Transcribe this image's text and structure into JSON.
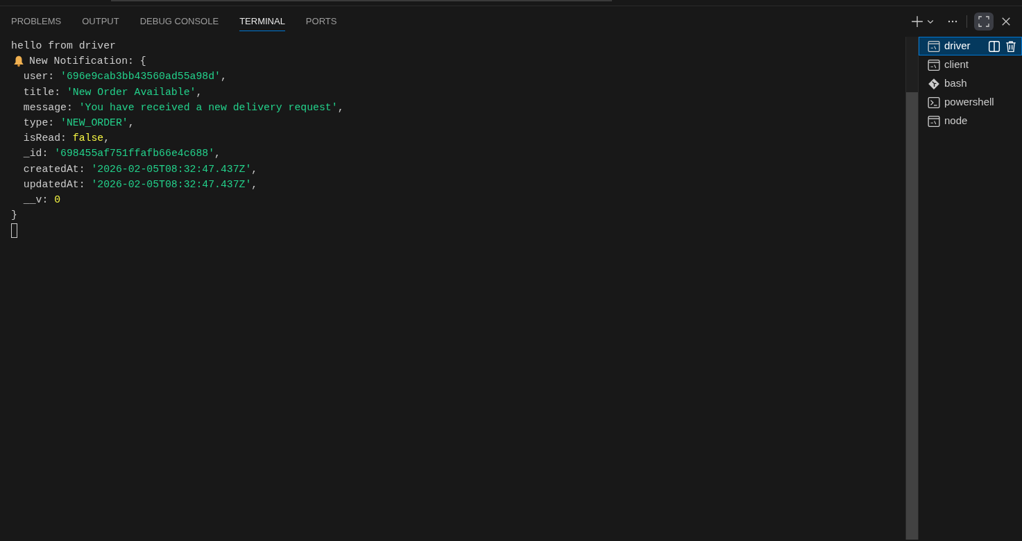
{
  "tabs": [
    {
      "label": "PROBLEMS",
      "selected": false
    },
    {
      "label": "OUTPUT",
      "selected": false
    },
    {
      "label": "DEBUG CONSOLE",
      "selected": false
    },
    {
      "label": "TERMINAL",
      "selected": true
    },
    {
      "label": "PORTS",
      "selected": false
    }
  ],
  "terminal_lines": [
    {
      "kind": "plain",
      "segments": [
        {
          "kind": "plain",
          "text": "hello from driver"
        }
      ]
    },
    {
      "kind": "alert",
      "segments": [
        {
          "kind": "plain",
          "text": "New Notification: {"
        }
      ]
    },
    {
      "kind": "plain",
      "segments": [
        {
          "kind": "plain",
          "text": "  user: "
        },
        {
          "kind": "string",
          "text": "'696e9cab3bb43560ad55a98d'"
        },
        {
          "kind": "plain",
          "text": ","
        }
      ]
    },
    {
      "kind": "plain",
      "segments": [
        {
          "kind": "plain",
          "text": "  title: "
        },
        {
          "kind": "string",
          "text": "'New Order Available'"
        },
        {
          "kind": "plain",
          "text": ","
        }
      ]
    },
    {
      "kind": "plain",
      "segments": [
        {
          "kind": "plain",
          "text": "  message: "
        },
        {
          "kind": "string",
          "text": "'You have received a new delivery request'"
        },
        {
          "kind": "plain",
          "text": ","
        }
      ]
    },
    {
      "kind": "plain",
      "segments": [
        {
          "kind": "plain",
          "text": "  type: "
        },
        {
          "kind": "string",
          "text": "'NEW_ORDER'"
        },
        {
          "kind": "plain",
          "text": ","
        }
      ]
    },
    {
      "kind": "plain",
      "segments": [
        {
          "kind": "plain",
          "text": "  isRead: "
        },
        {
          "kind": "literal",
          "text": "false"
        },
        {
          "kind": "plain",
          "text": ","
        }
      ]
    },
    {
      "kind": "plain",
      "segments": [
        {
          "kind": "plain",
          "text": "  _id: "
        },
        {
          "kind": "string",
          "text": "'698455af751ffafb66e4c688'"
        },
        {
          "kind": "plain",
          "text": ","
        }
      ]
    },
    {
      "kind": "plain",
      "segments": [
        {
          "kind": "plain",
          "text": "  createdAt: "
        },
        {
          "kind": "string",
          "text": "'2026-02-05T08:32:47.437Z'"
        },
        {
          "kind": "plain",
          "text": ","
        }
      ]
    },
    {
      "kind": "plain",
      "segments": [
        {
          "kind": "plain",
          "text": "  updatedAt: "
        },
        {
          "kind": "string",
          "text": "'2026-02-05T08:32:47.437Z'"
        },
        {
          "kind": "plain",
          "text": ","
        }
      ]
    },
    {
      "kind": "plain",
      "segments": [
        {
          "kind": "plain",
          "text": "  __v: "
        },
        {
          "kind": "literal",
          "text": "0"
        }
      ]
    },
    {
      "kind": "plain",
      "segments": [
        {
          "kind": "plain",
          "text": "}"
        }
      ]
    }
  ],
  "terminals": [
    {
      "name": "driver",
      "kind": "cmd",
      "selected": true
    },
    {
      "name": "client",
      "kind": "cmd",
      "selected": false
    },
    {
      "name": "bash",
      "kind": "git",
      "selected": false
    },
    {
      "name": "powershell",
      "kind": "powershell",
      "selected": false
    },
    {
      "name": "node",
      "kind": "cmd",
      "selected": false
    }
  ]
}
